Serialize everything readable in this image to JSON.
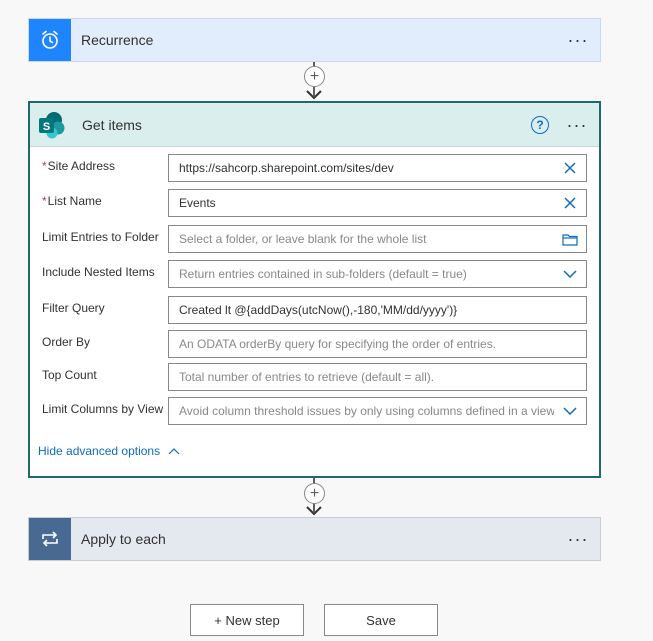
{
  "recurrence": {
    "title": "Recurrence",
    "more": "···",
    "icon": "alarm-clock-icon",
    "accent": "#1f85ff"
  },
  "get_items": {
    "title": "Get items",
    "more": "···",
    "help": "?",
    "icon": "sharepoint-icon",
    "accent": "#036c70",
    "fields": [
      {
        "label": "Site Address",
        "required": "*",
        "value": "https://sahcorp.sharepoint.com/sites/dev"
      },
      {
        "label": "List Name",
        "required": "*",
        "value": "Events"
      },
      {
        "label": "Limit Entries to Folder",
        "placeholder": "Select a folder, or leave blank for the whole list"
      },
      {
        "label": "Include Nested Items",
        "placeholder": "Return entries contained in sub-folders (default = true)"
      },
      {
        "label": "Filter Query",
        "value": "Created lt @{addDays(utcNow(),-180,'MM/dd/yyyy')}"
      },
      {
        "label": "Order By",
        "placeholder": "An ODATA orderBy query for specifying the order of entries."
      },
      {
        "label": "Top Count",
        "placeholder": "Total number of entries to retrieve (default = all)."
      },
      {
        "label": "Limit Columns by View",
        "placeholder": "Avoid column threshold issues by only using columns defined in a view"
      }
    ],
    "hide_advanced": "Hide advanced options"
  },
  "apply_to_each": {
    "title": "Apply to each",
    "more": "···",
    "icon": "loop-icon",
    "accent": "#486991"
  },
  "buttons": {
    "new_step": "+ New step",
    "save": "Save"
  },
  "connectors": {
    "plus": "+"
  }
}
